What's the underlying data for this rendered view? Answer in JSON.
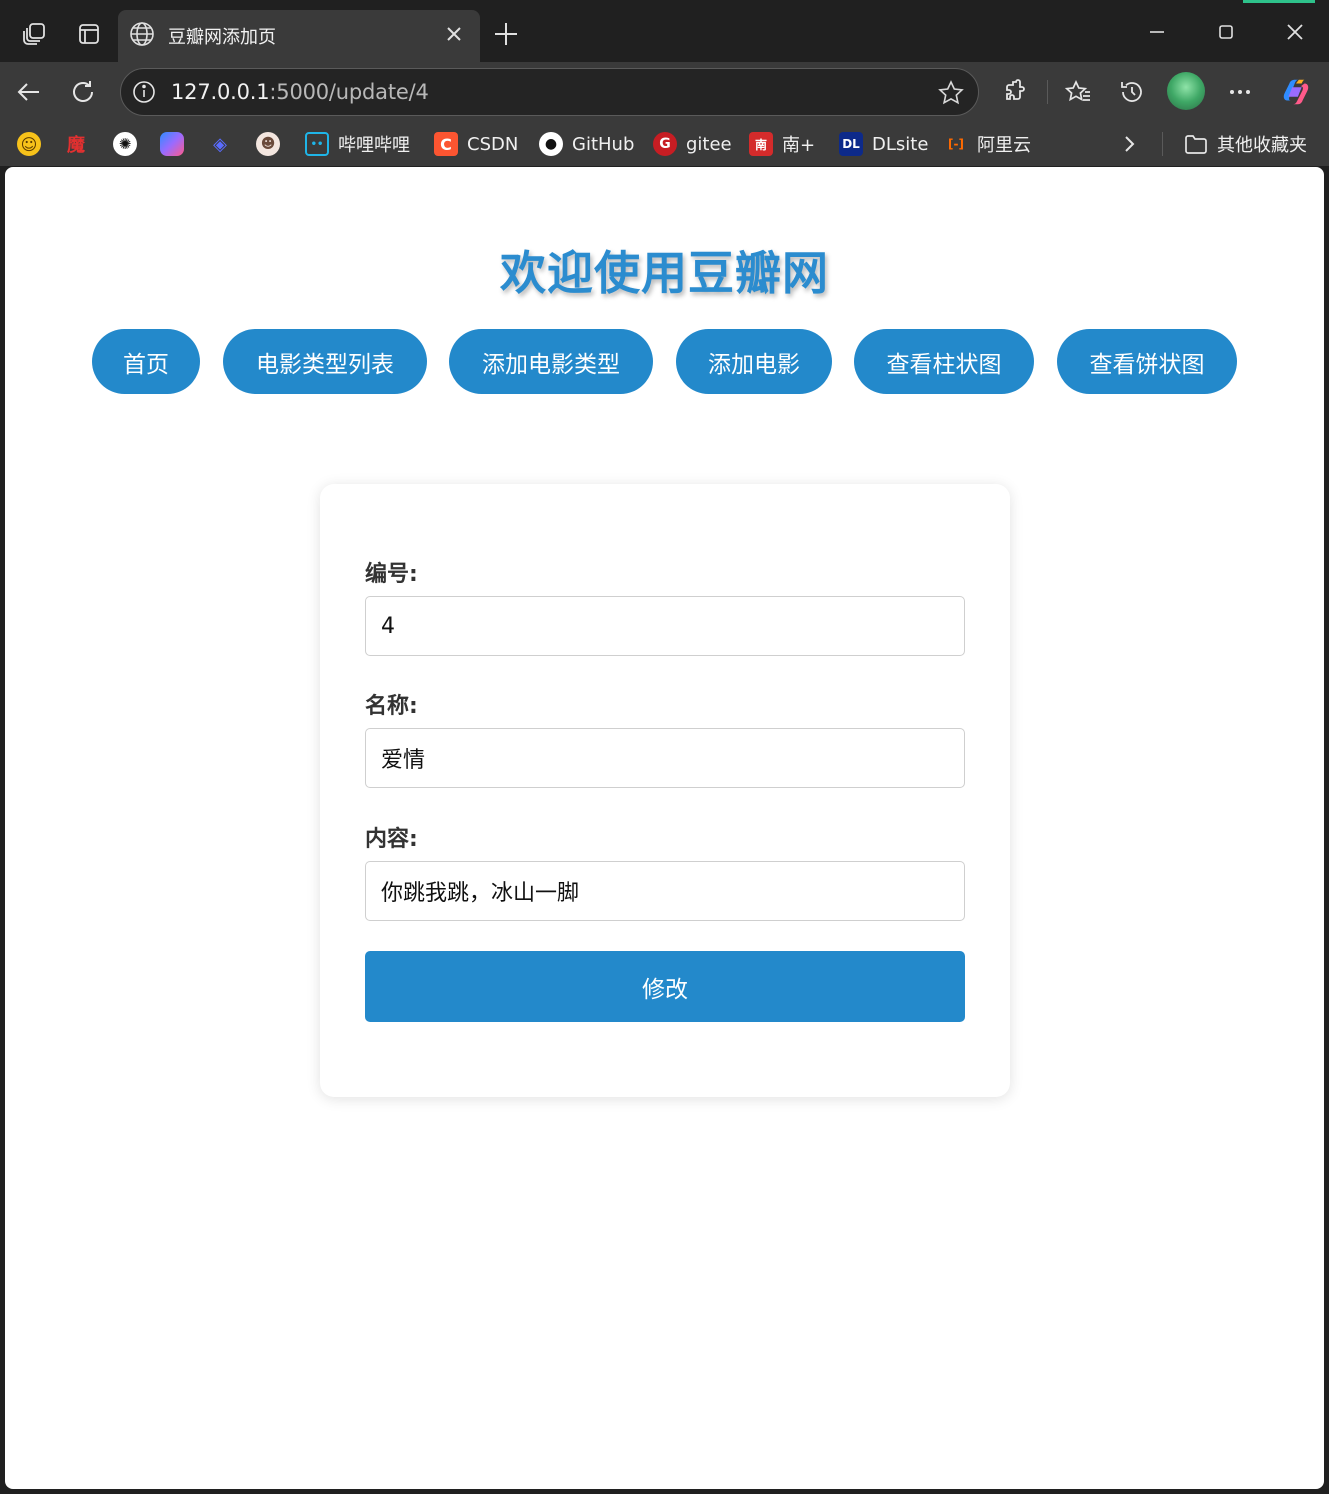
{
  "browser": {
    "tab_title": "豆瓣网添加页",
    "url_host": "127.0.0.1",
    "url_rest": ":5000/update/4",
    "accent_color": "#2ec28b"
  },
  "bookmarks": [
    {
      "icon": "smiley-icon",
      "label": ""
    },
    {
      "icon": "mo-icon",
      "label": "",
      "glyph": "魔"
    },
    {
      "icon": "openai-icon",
      "label": ""
    },
    {
      "icon": "copilot-icon",
      "label": ""
    },
    {
      "icon": "whale-icon",
      "label": ""
    },
    {
      "icon": "anime-avatar-icon",
      "label": ""
    },
    {
      "icon": "bilibili-icon",
      "label": "哔哩哔哩"
    },
    {
      "icon": "csdn-icon",
      "label": "CSDN",
      "glyph": "C"
    },
    {
      "icon": "github-icon",
      "label": "GitHub"
    },
    {
      "icon": "gitee-icon",
      "label": "gitee",
      "glyph": "G"
    },
    {
      "icon": "nanplus-icon",
      "label": "南+",
      "glyph": "南"
    },
    {
      "icon": "dlsite-icon",
      "label": "DLsite",
      "glyph": "DL"
    },
    {
      "icon": "aliyun-icon",
      "label": "阿里云",
      "glyph": "[-]"
    }
  ],
  "other_bookmarks": "其他收藏夹",
  "page": {
    "title": "欢迎使用豆瓣网",
    "brand_color": "#2389cb",
    "nav": [
      {
        "label": "首页"
      },
      {
        "label": "电影类型列表"
      },
      {
        "label": "添加电影类型"
      },
      {
        "label": "添加电影"
      },
      {
        "label": "查看柱状图"
      },
      {
        "label": "查看饼状图"
      }
    ],
    "form": {
      "id_label": "编号:",
      "id_value": "4",
      "name_label": "名称:",
      "name_value": "爱情",
      "content_label": "内容:",
      "content_value": "你跳我跳，冰山一脚",
      "submit_label": "修改"
    }
  }
}
